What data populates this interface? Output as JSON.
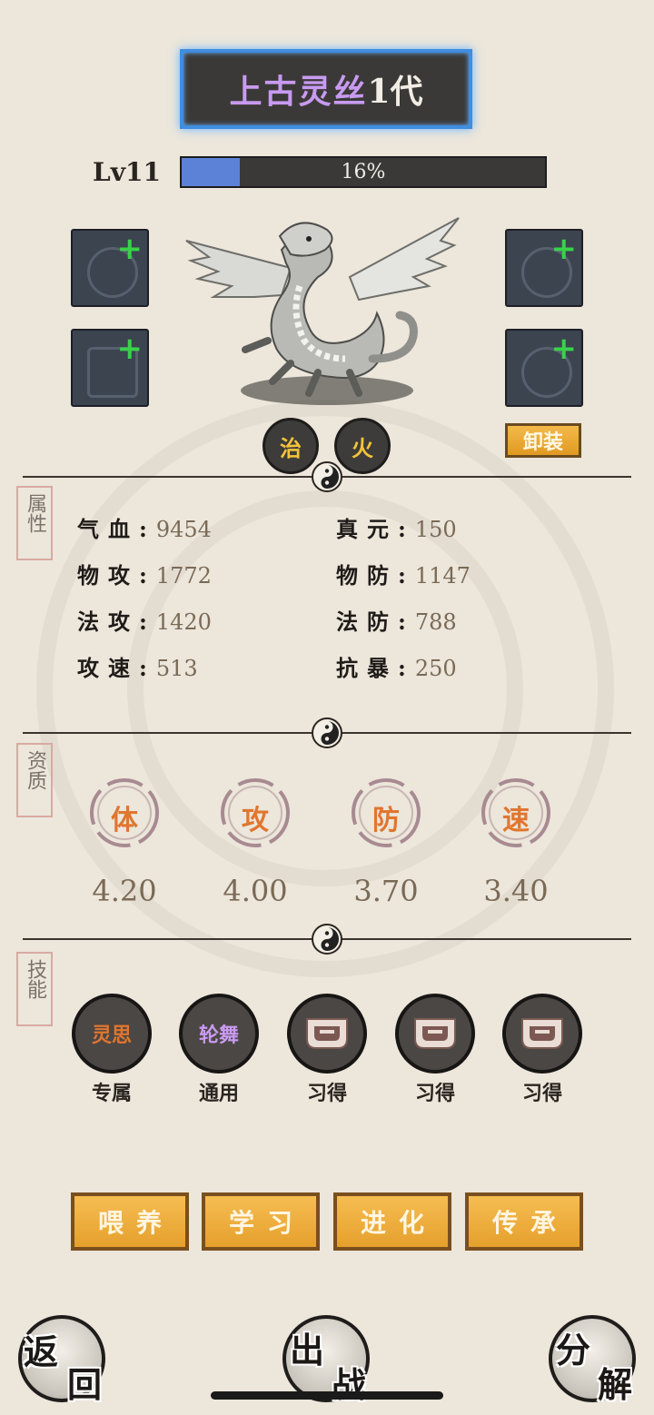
{
  "pet": {
    "name_main": "上古灵丝",
    "name_gen": "1代",
    "level": "Lv11",
    "exp_percent": 16,
    "exp_text": "16%"
  },
  "elements": [
    "治",
    "火"
  ],
  "unequip_label": "卸装",
  "sections": {
    "attributes": "属性",
    "aptitude": "资质",
    "skills": "技能"
  },
  "stats": [
    {
      "label": "气血:",
      "value": "9454"
    },
    {
      "label": "真元:",
      "value": "150"
    },
    {
      "label": "物攻:",
      "value": "1772"
    },
    {
      "label": "物防:",
      "value": "1147"
    },
    {
      "label": "法攻:",
      "value": "1420"
    },
    {
      "label": "法防:",
      "value": "788"
    },
    {
      "label": "攻速:",
      "value": "513"
    },
    {
      "label": "抗暴:",
      "value": "250"
    }
  ],
  "aptitudes": [
    {
      "char": "体",
      "value": "4.20"
    },
    {
      "char": "攻",
      "value": "4.00"
    },
    {
      "char": "防",
      "value": "3.70"
    },
    {
      "char": "速",
      "value": "3.40"
    }
  ],
  "skills": [
    {
      "name": "灵思",
      "label": "专属",
      "color": "#e0762f"
    },
    {
      "name": "轮舞",
      "label": "通用",
      "color": "#c89af0"
    },
    {
      "name": "",
      "label": "习得"
    },
    {
      "name": "",
      "label": "习得"
    },
    {
      "name": "",
      "label": "习得"
    }
  ],
  "actions": [
    "喂养",
    "学习",
    "进化",
    "传承"
  ],
  "bottom": {
    "back_1": "返",
    "back_2": "回",
    "fight_1": "出",
    "fight_2": "战",
    "decompose_1": "分",
    "decompose_2": "解"
  }
}
